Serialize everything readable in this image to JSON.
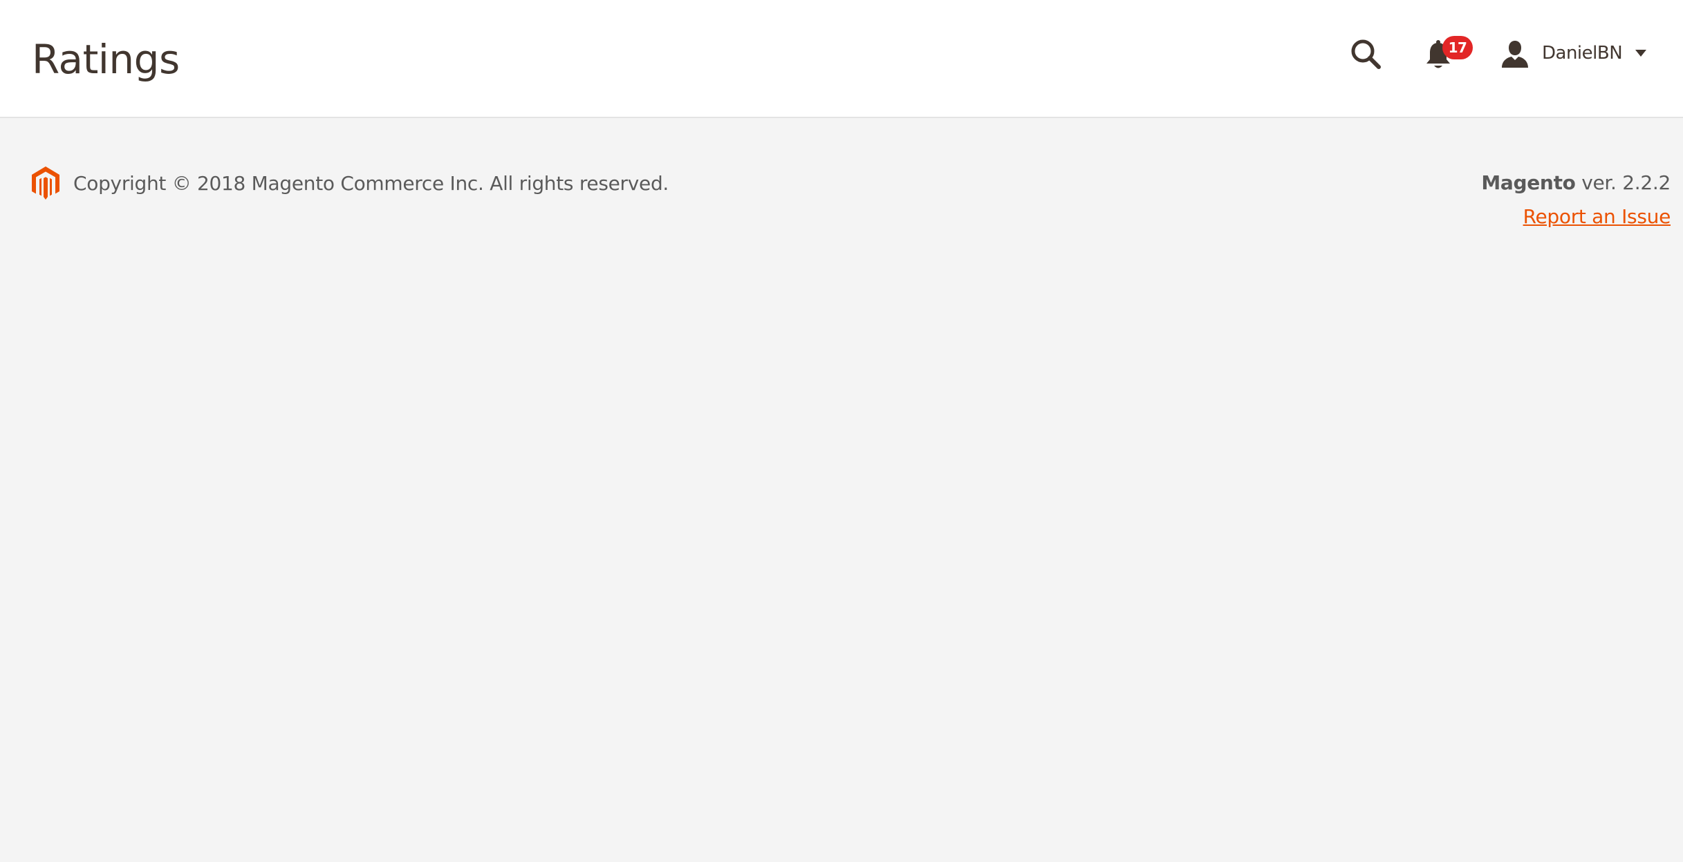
{
  "header": {
    "title": "Ratings",
    "search_icon": "search-icon",
    "notifications": {
      "icon": "bell-icon",
      "count": "17"
    },
    "user": {
      "icon": "user-icon",
      "name": "DanielBN",
      "caret_icon": "caret-down-icon"
    }
  },
  "footer": {
    "logo_icon": "magento-logo-icon",
    "copyright": "Copyright © 2018 Magento Commerce Inc. All rights reserved.",
    "brand": "Magento",
    "version": "ver. 2.2.2",
    "report_link": "Report an Issue"
  },
  "colors": {
    "accent": "#eb5202",
    "badge": "#e22626",
    "text": "#41362f",
    "background": "#f4f4f4",
    "header_background": "#ffffff"
  }
}
